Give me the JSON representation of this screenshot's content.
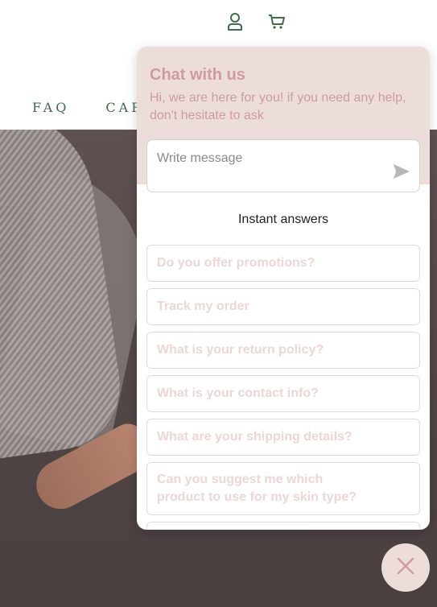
{
  "header": {
    "icons": [
      "account-icon",
      "cart-icon"
    ],
    "nav": [
      {
        "label": "FAQ"
      },
      {
        "label": "CAR"
      }
    ]
  },
  "chat": {
    "title": "Chat with us",
    "subtitle": "Hi, we are here for you! if you need any help, don't hesitate to ask",
    "message_placeholder": "Write message",
    "instant_answers_title": "Instant answers",
    "answers": [
      {
        "label": "Do you offer promotions?"
      },
      {
        "label": "Track my order"
      },
      {
        "label": "What is your return policy?"
      },
      {
        "label": "What is your contact info?"
      },
      {
        "label": "What are your shipping details?"
      },
      {
        "label": "Can you suggest me which product to use for my skin type?"
      }
    ]
  },
  "colors": {
    "brand_green": "#3f6b4f",
    "chat_pink": "#ecdddb",
    "chat_text_pink": "#cd9c9f",
    "answer_text": "#ecd6d6"
  }
}
